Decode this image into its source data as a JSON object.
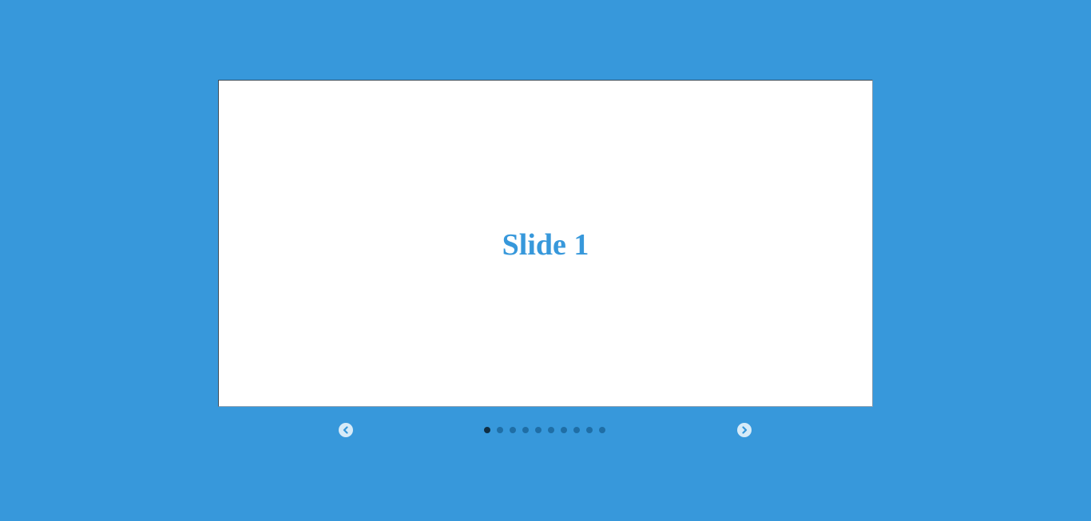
{
  "colors": {
    "background": "#3798db",
    "slide_background": "#ffffff",
    "slide_text": "#3798db",
    "dot_inactive": "#1f6ea6",
    "dot_active": "#0f2e44",
    "nav_button": "#d7ebf8"
  },
  "carousel": {
    "current_slide": {
      "title": "Slide 1"
    },
    "slide_count": 10,
    "active_index": 0,
    "prev_icon": "chevron-left-circle-icon",
    "next_icon": "chevron-right-circle-icon"
  }
}
